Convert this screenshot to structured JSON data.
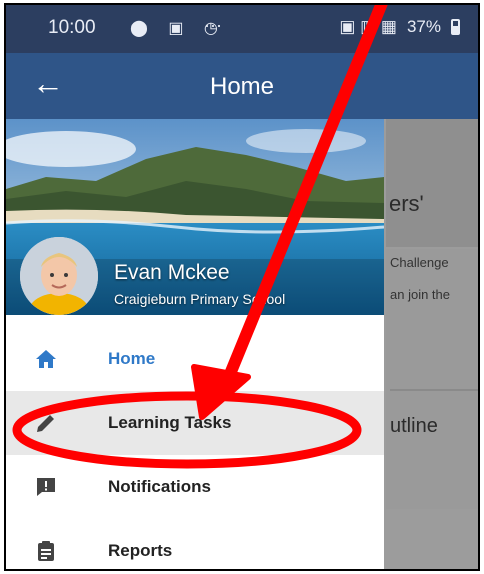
{
  "status_bar": {
    "time": "10:00",
    "left_icons": "⬤ ▣ ◷",
    "dots": "···",
    "signal_text": "▣ ▥ ▦",
    "battery": "37%"
  },
  "app_bar": {
    "title": "Home",
    "back_icon": "arrow-left-icon"
  },
  "drawer": {
    "profile": {
      "name": "Evan Mckee",
      "school": "Craigieburn Primary School"
    },
    "items": [
      {
        "label": "Home",
        "icon": "home-icon",
        "active": true
      },
      {
        "label": "Learning Tasks",
        "icon": "pencil-icon",
        "active": false
      },
      {
        "label": "Notifications",
        "icon": "notification-icon",
        "active": false
      },
      {
        "label": "Reports",
        "icon": "clipboard-icon",
        "active": false
      }
    ]
  },
  "background": {
    "heading": "ers'",
    "line1": "Challenge",
    "line2": "an join the",
    "heading2": "utline"
  },
  "colors": {
    "status_bar": "#2c3e60",
    "app_bar": "#2f5588",
    "active_item": "#2f79c8",
    "annotation": "#ff0000"
  }
}
